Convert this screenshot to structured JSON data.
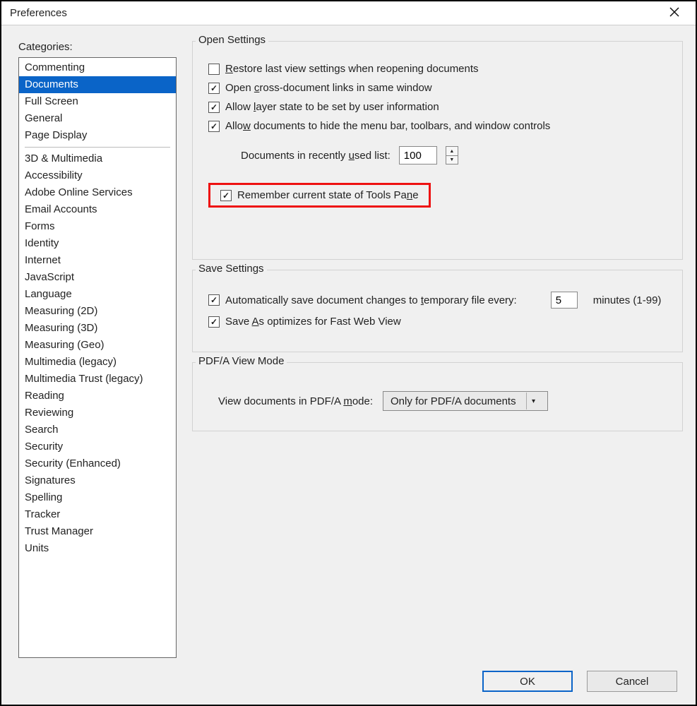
{
  "window": {
    "title": "Preferences"
  },
  "categories": {
    "label": "Categories:",
    "top": [
      {
        "label": "Commenting"
      },
      {
        "label": "Documents",
        "selected": true
      },
      {
        "label": "Full Screen"
      },
      {
        "label": "General"
      },
      {
        "label": "Page Display"
      }
    ],
    "rest": [
      {
        "label": "3D & Multimedia"
      },
      {
        "label": "Accessibility"
      },
      {
        "label": "Adobe Online Services"
      },
      {
        "label": "Email Accounts"
      },
      {
        "label": "Forms"
      },
      {
        "label": "Identity"
      },
      {
        "label": "Internet"
      },
      {
        "label": "JavaScript"
      },
      {
        "label": "Language"
      },
      {
        "label": "Measuring (2D)"
      },
      {
        "label": "Measuring (3D)"
      },
      {
        "label": "Measuring (Geo)"
      },
      {
        "label": "Multimedia (legacy)"
      },
      {
        "label": "Multimedia Trust (legacy)"
      },
      {
        "label": "Reading"
      },
      {
        "label": "Reviewing"
      },
      {
        "label": "Search"
      },
      {
        "label": "Security"
      },
      {
        "label": "Security (Enhanced)"
      },
      {
        "label": "Signatures"
      },
      {
        "label": "Spelling"
      },
      {
        "label": "Tracker"
      },
      {
        "label": "Trust Manager"
      },
      {
        "label": "Units"
      }
    ]
  },
  "open_settings": {
    "legend": "Open Settings",
    "restore": {
      "label": "Restore last view settings when reopening documents",
      "checked": false
    },
    "cross_links": {
      "label": "Open cross-document links in same window",
      "checked": true
    },
    "layer_state": {
      "label": "Allow layer state to be set by user information",
      "checked": true
    },
    "hide_menu": {
      "label": "Allow documents to hide the menu bar, toolbars, and window controls",
      "checked": true
    },
    "recent": {
      "label": "Documents in recently used list:",
      "value": "100"
    },
    "remember_tools": {
      "label": "Remember current state of Tools Pane",
      "checked": true
    }
  },
  "save_settings": {
    "legend": "Save Settings",
    "autosave": {
      "label": "Automatically save document changes to temporary file every:",
      "checked": true,
      "value": "5",
      "suffix": "minutes (1-99)"
    },
    "fast_web": {
      "label": "Save As optimizes for Fast Web View",
      "checked": true
    }
  },
  "pdfa": {
    "legend": "PDF/A View Mode",
    "label": "View documents in PDF/A mode:",
    "selected": "Only for PDF/A documents"
  },
  "buttons": {
    "ok": "OK",
    "cancel": "Cancel"
  }
}
